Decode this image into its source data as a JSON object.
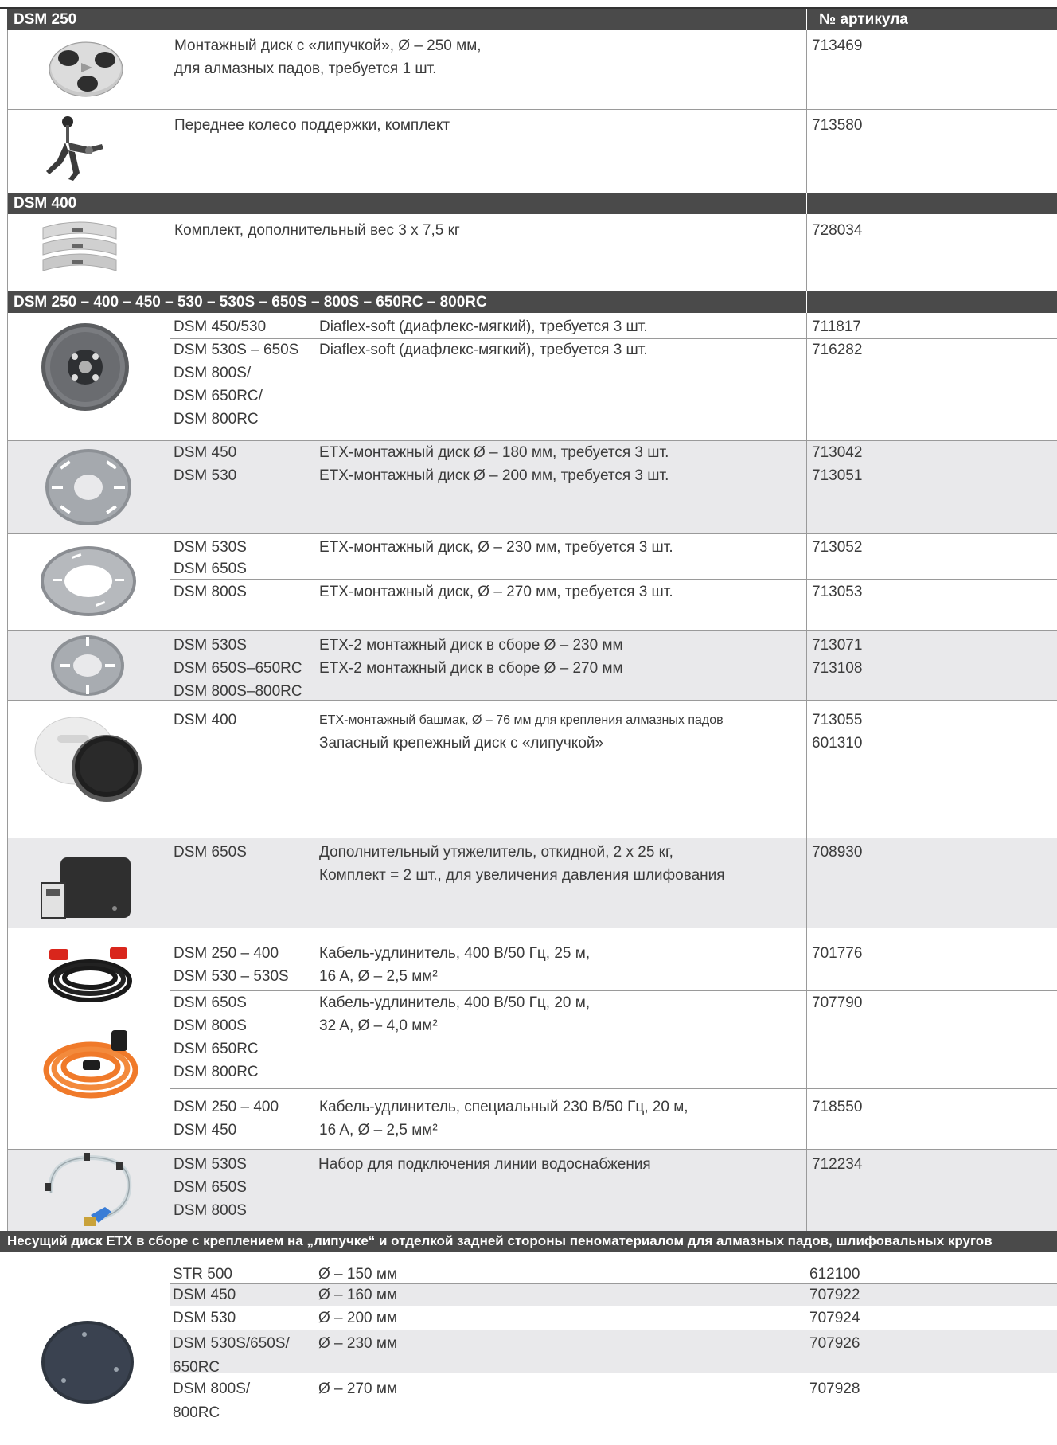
{
  "headers": {
    "dsm250": "DSM 250",
    "article_header": "№ артикула",
    "dsm400": "DSM 400",
    "multi": "DSM 250 – 400 – 450 – 530 – 530S – 650S – 800S – 650RC – 800RC",
    "etx": "Несущий диск ETX в сборе с креплением на „липучке“ и отделкой задней стороны пеноматериалом для алмазных падов, шлифовальных кругов"
  },
  "rows": {
    "r1": {
      "desc1": "Монтажный диск с «липучкой», Ø – 250 мм,",
      "desc2": "для алмазных падов, требуется 1 шт.",
      "art": "713469"
    },
    "r2": {
      "desc": "Переднее колесо поддержки, комплект",
      "art": "713580"
    },
    "r3": {
      "desc": "Комплект, дополнительный вес 3 x 7,5 кг",
      "art": "728034"
    },
    "r4": {
      "m1": "DSM 450/530",
      "d1": "Diaflex-soft (диафлекс-мягкий), требуется 3 шт.",
      "a1": "711817",
      "m2": "DSM 530S – 650S",
      "m3": "DSM 800S/",
      "m4": "DSM 650RC/",
      "m5": "DSM 800RC",
      "d2": "Diaflex-soft (диафлекс-мягкий), требуется 3 шт.",
      "a2": "716282"
    },
    "r5": {
      "m1": "DSM 450",
      "d1": "ETX-монтажный диск Ø – 180 мм, требуется 3 шт.",
      "a1": "713042",
      "m2": "DSM 530",
      "d2": "ETX-монтажный диск Ø – 200 мм, требуется 3 шт.",
      "a2": "713051"
    },
    "r6": {
      "m1": "DSM 530S",
      "m2": "DSM 650S",
      "d1": "ETX-монтажный диск, Ø – 230 мм, требуется 3 шт.",
      "a1": "713052",
      "m3": "DSM 800S",
      "d2": "ETX-монтажный диск, Ø – 270 мм, требуется 3 шт.",
      "a2": "713053"
    },
    "r7": {
      "m1": "DSM 530S",
      "m2": "DSM 650S–650RC",
      "m3": "DSM 800S–800RC",
      "d1": "ETX-2 монтажный диск в сборе Ø – 230 мм",
      "d2": "ETX-2 монтажный диск в сборе Ø – 270 мм",
      "a1": "713071",
      "a2": "713108"
    },
    "r8": {
      "m1": "DSM 400",
      "d1": "ETX-монтажный башмак, Ø – 76 мм для крепления алмазных падов",
      "d2": "Запасный крепежный диск с «липучкой»",
      "a1": "713055",
      "a2": "601310"
    },
    "r9": {
      "m1": "DSM 650S",
      "d1": "Дополнительный утяжелитель, откидной, 2 x 25 кг,",
      "d2": "Комплект = 2 шт., для увеличения давления шлифования",
      "a1": "708930"
    },
    "r10": {
      "m1": "DSM 250 – 400",
      "m2": "DSM 530 – 530S",
      "d1": "Кабель-удлинитель, 400 В/50 Гц, 25 м,",
      "d2": "16 A, Ø – 2,5 мм²",
      "a1": "701776",
      "m3": "DSM 650S",
      "m4": "DSM 800S",
      "m5": "DSM 650RC",
      "m6": "DSM 800RC",
      "d3": "Кабель-удлинитель, 400 В/50 Гц, 20 м,",
      "d4": "32 A, Ø – 4,0 мм²",
      "a2": "707790",
      "m7": "DSM 250 – 400",
      "m8": "DSM 450",
      "d5": "Кабель-удлинитель, специальный 230 В/50 Гц, 20 м,",
      "d6": "16 A, Ø – 2,5 мм²",
      "a3": "718550"
    },
    "r11": {
      "m1": "DSM 530S",
      "m2": "DSM 650S",
      "m3": "DSM 800S",
      "d1": "Набор для подключения линии водоснабжения",
      "a1": "712234"
    },
    "r12": {
      "m1": "STR 500",
      "d1": "Ø – 150 мм",
      "a1": "612100",
      "m2": "DSM 450",
      "d2": "Ø – 160 мм",
      "a2": "707922",
      "m3": "DSM 530",
      "d3": "Ø – 200 мм",
      "a3": "707924",
      "m4a": "DSM 530S/650S/",
      "m4b": "650RC",
      "d4": "Ø – 230 мм",
      "a4": "707926",
      "m5a": "DSM 800S/",
      "m5b": "800RC",
      "d5": "Ø – 270 мм",
      "a5": "707928"
    }
  }
}
